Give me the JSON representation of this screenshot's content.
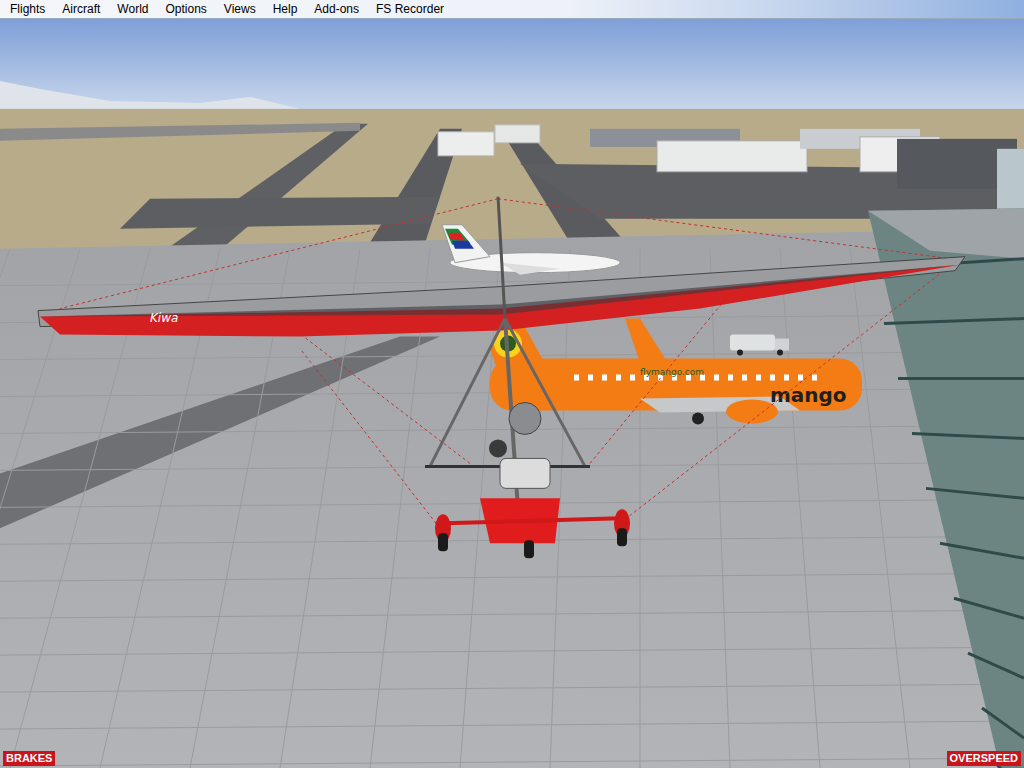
{
  "menu_bar": {
    "items": [
      "Flights",
      "Aircraft",
      "World",
      "Options",
      "Views",
      "Help",
      "Add-ons",
      "FS Recorder"
    ]
  },
  "scene": {
    "livery_texts": {
      "wing": "Kiwa",
      "fuselage_url": "flymango.com",
      "fuselage_logo": "mango"
    }
  },
  "status_indicators": [
    {
      "label": "BRAKES",
      "on": true
    },
    {
      "label": "OVERSPEED",
      "on": true
    }
  ]
}
